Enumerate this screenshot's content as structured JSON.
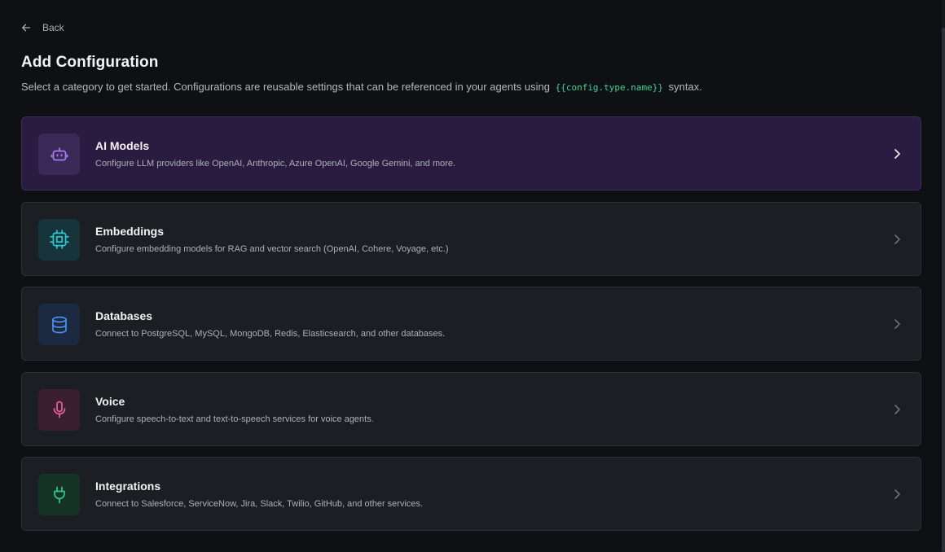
{
  "nav": {
    "back_label": "Back"
  },
  "header": {
    "title": "Add Configuration",
    "subtitle_before": "Select a category to get started. Configurations are reusable settings that can be referenced in your agents using",
    "syntax_code": "{{config.type.name}}",
    "subtitle_after": "syntax."
  },
  "categories": [
    {
      "title": "AI Models",
      "description": "Configure LLM providers like OpenAI, Anthropic, Azure OpenAI, Google Gemini, and more.",
      "icon": "robot-icon",
      "accent": "#a77bf3",
      "icon_bg": "#3a2856",
      "selected": true
    },
    {
      "title": "Embeddings",
      "description": "Configure embedding models for RAG and vector search (OpenAI, Cohere, Voyage, etc.)",
      "icon": "chip-icon",
      "accent": "#2cc7d2",
      "icon_bg": "#16343a",
      "selected": false
    },
    {
      "title": "Databases",
      "description": "Connect to PostgreSQL, MySQL, MongoDB, Redis, Elasticsearch, and other databases.",
      "icon": "database-icon",
      "accent": "#4c8ff0",
      "icon_bg": "#1b2a40",
      "selected": false
    },
    {
      "title": "Voice",
      "description": "Configure speech-to-text and text-to-speech services for voice agents.",
      "icon": "microphone-icon",
      "accent": "#e8619f",
      "icon_bg": "#3a1f2e",
      "selected": false
    },
    {
      "title": "Integrations",
      "description": "Connect to Salesforce, ServiceNow, Jira, Slack, Twilio, GitHub, and other services.",
      "icon": "plug-icon",
      "accent": "#2fc486",
      "icon_bg": "#163328",
      "selected": false
    }
  ]
}
